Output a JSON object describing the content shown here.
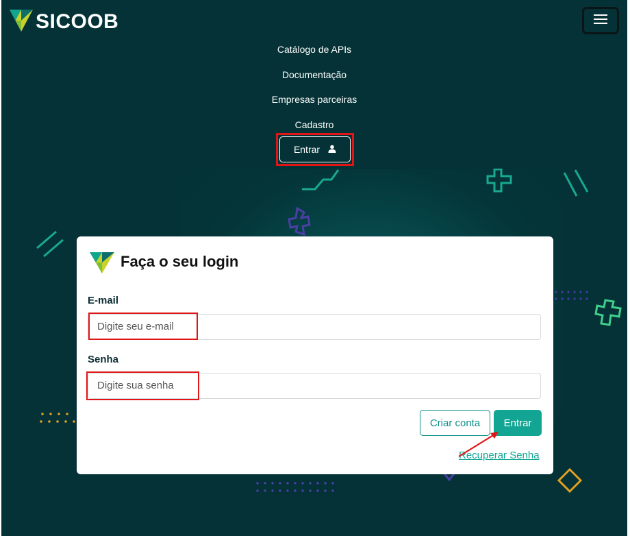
{
  "brand": {
    "name": "SICOOB"
  },
  "nav": {
    "items": [
      {
        "label": "Catálogo de APIs"
      },
      {
        "label": "Documentação"
      },
      {
        "label": "Empresas parceiras"
      },
      {
        "label": "Cadastro"
      }
    ],
    "login_label": "Entrar"
  },
  "login": {
    "title": "Faça o seu login",
    "email_label": "E-mail",
    "email_placeholder": "Digite seu e-mail",
    "password_label": "Senha",
    "password_placeholder": "Digite sua senha",
    "create_account": "Criar conta",
    "submit": "Entrar",
    "recover": "Recuperar Senha"
  },
  "colors": {
    "background": "#043236",
    "accent": "#12a593",
    "highlight": "#e01616"
  },
  "icons": [
    "logo-icon",
    "menu-icon",
    "user-icon"
  ]
}
